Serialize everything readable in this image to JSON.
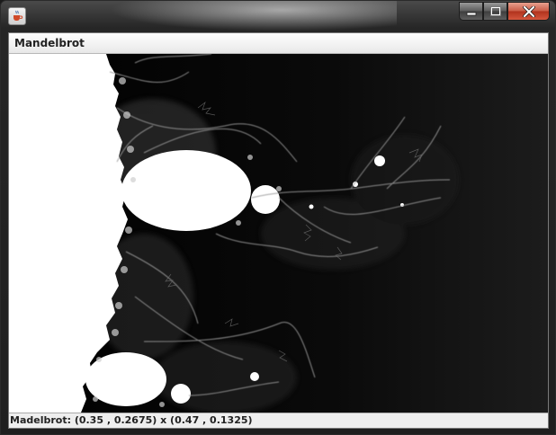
{
  "window": {
    "title": "",
    "app_icon": "java-cup-icon",
    "controls": [
      "minimize-icon",
      "maximize-icon",
      "close-icon"
    ]
  },
  "menubar": {
    "items": [
      {
        "label": "Mandelbrot"
      }
    ]
  },
  "canvas": {
    "content": "Mandelbrot fractal rendering (white set on black, grey filaments)",
    "colors": {
      "background": "#0a0a0a",
      "set": "#ffffff",
      "filaments": "#9a9a9a"
    }
  },
  "statusbar": {
    "text": "Madelbrot: (0.35 , 0.2675) x (0.47 , 0.1325)"
  }
}
